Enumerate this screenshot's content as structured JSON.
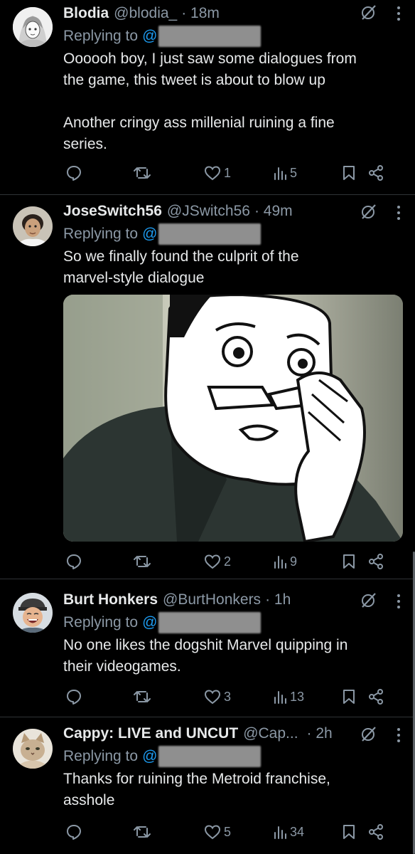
{
  "tweets": [
    {
      "name": "Blodia",
      "handle": "@blodia_",
      "time": "· 18m",
      "replying_prefix": "Replying to",
      "replying_at": "@",
      "text": "Oooooh boy, I just saw some dialogues from\nthe game, this tweet is about to blow up\n\nAnother cringy ass millenial ruining a fine\nseries.",
      "likes": "1",
      "views": "5",
      "avatar_icon": "anime-girl-avatar"
    },
    {
      "name": "JoseSwitch56",
      "handle": "@JSwitch56",
      "time": "· 49m",
      "replying_prefix": "Replying to",
      "replying_at": "@",
      "text": "So we finally found the culprit of the\nmarvel-style dialogue",
      "likes": "2",
      "views": "9",
      "avatar_icon": "man-portrait-avatar",
      "media": "meme-face-image"
    },
    {
      "name": "Burt Honkers",
      "handle": "@BurtHonkers",
      "time": "· 1h",
      "replying_prefix": "Replying to",
      "replying_at": "@",
      "text": "No one likes the dogshit Marvel quipping in\ntheir videogames.",
      "likes": "3",
      "views": "13",
      "avatar_icon": "laughing-kid-avatar"
    },
    {
      "name": "Cappy: LIVE and UNCUT",
      "handle": "@Cap...",
      "time": "· 2h",
      "replying_prefix": "Replying to",
      "replying_at": "@",
      "text": "Thanks for ruining the Metroid franchise,\nasshole",
      "likes": "5",
      "views": "34",
      "avatar_icon": "cat-avatar"
    }
  ],
  "colors": {
    "background": "#000000",
    "text": "#e7e9ea",
    "secondary": "#8b98a5",
    "link": "#1d9bf0",
    "divider": "#2f3336"
  }
}
